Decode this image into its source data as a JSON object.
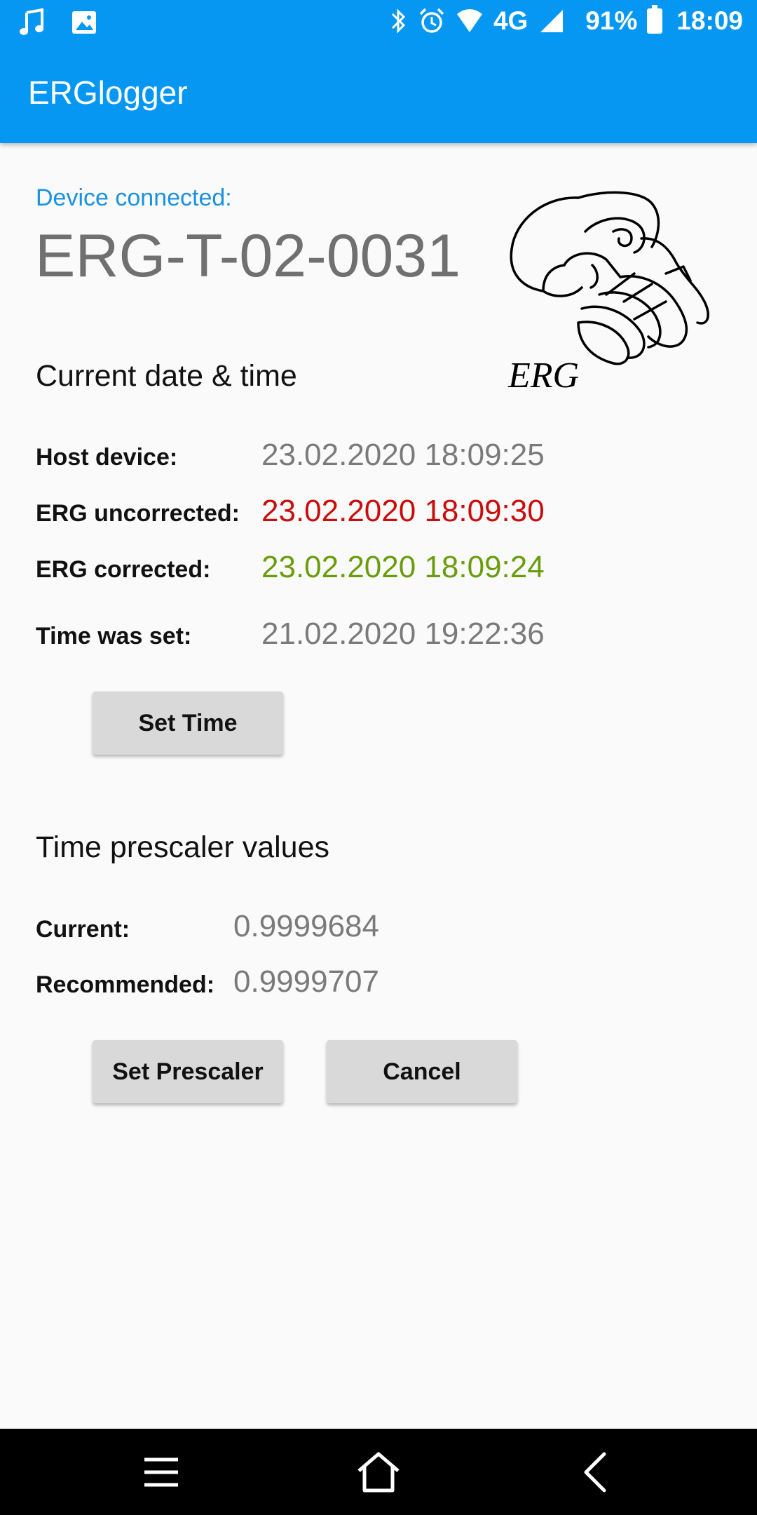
{
  "status_bar": {
    "left_icons": [
      "music-note-icon",
      "image-icon"
    ],
    "right_icons": [
      "bluetooth-icon",
      "alarm-icon",
      "wifi-icon",
      "signal-icon",
      "battery-icon"
    ],
    "network": "4G",
    "battery": "91%",
    "time": "18:09"
  },
  "app_bar": {
    "title": "ERGlogger"
  },
  "device": {
    "label": "Device connected:",
    "name": "ERG-T-02-0031"
  },
  "logo": {
    "text": "ERG"
  },
  "date_time": {
    "title": "Current date & time",
    "rows": [
      {
        "label": "Host device:",
        "value": "23.02.2020 18:09:25"
      },
      {
        "label": "ERG uncorrected:",
        "value": "23.02.2020 18:09:30"
      },
      {
        "label": "ERG corrected:",
        "value": "23.02.2020 18:09:24"
      },
      {
        "label": "Time was set:",
        "value": "21.02.2020 19:22:36"
      }
    ],
    "set_time_label": "Set Time"
  },
  "prescaler": {
    "title": "Time prescaler values",
    "rows": [
      {
        "label": "Current:",
        "value": "0.9999684"
      },
      {
        "label": "Recommended:",
        "value": "0.9999707"
      }
    ],
    "set_prescaler_label": "Set Prescaler",
    "cancel_label": "Cancel"
  },
  "nav_bar": {
    "icons": [
      "menu-icon",
      "home-icon",
      "back-icon"
    ]
  },
  "colors": {
    "app_bar": "#0597f2",
    "device_label": "#1a92e0",
    "uncorrected": "#cc0b0b",
    "corrected": "#6a9d0c"
  }
}
